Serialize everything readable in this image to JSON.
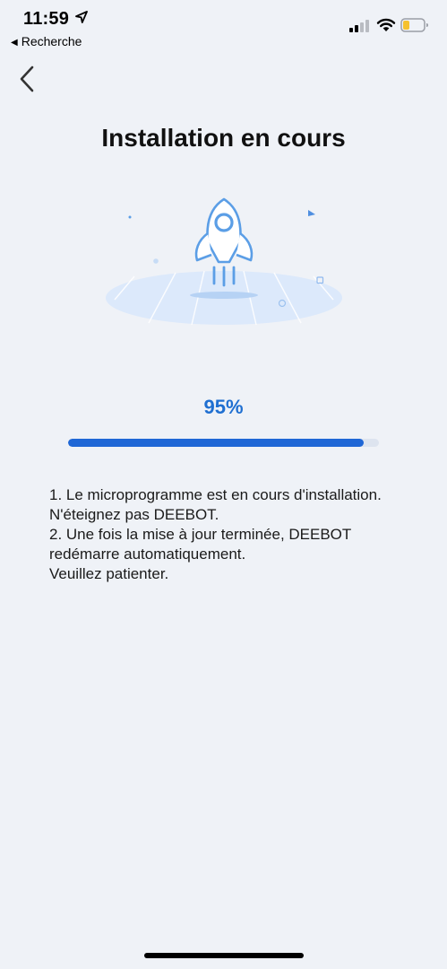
{
  "status_bar": {
    "time": "11:59",
    "back_app_label": "Recherche",
    "icons": [
      "location-arrow-icon",
      "signal-bars-icon",
      "wifi-icon",
      "battery-icon"
    ],
    "battery_color": "#f5c12e"
  },
  "header": {
    "back_icon": "chevron-left-icon",
    "title": "Installation en cours"
  },
  "illustration": {
    "icon": "rocket-icon",
    "accent_color": "#5b9ee6"
  },
  "progress": {
    "value_text": "95%",
    "fraction": 0.95,
    "fill_color": "#1f67d6"
  },
  "instructions": {
    "line1": "1. Le microprogramme est en cours d'installation. N'éteignez pas DEEBOT.",
    "line2": "2. Une fois la mise à jour terminée, DEEBOT redémarre automatiquement.",
    "line3": "Veuillez patienter."
  }
}
